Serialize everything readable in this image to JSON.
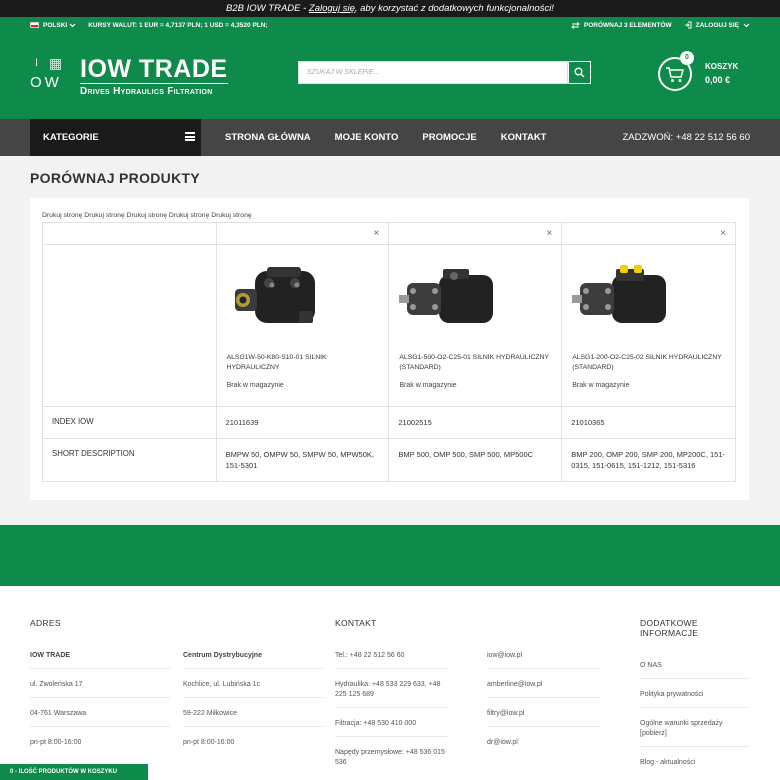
{
  "banner": {
    "pre": "B2B IOW TRADE - ",
    "link": "Zaloguj się",
    "post": ", aby korzystać z dodatkowych funkcjonalności!"
  },
  "topbar": {
    "language": "POLSKI",
    "currency": "KURSY WALUT: 1 EUR = 4,7137 PLN; 1 USD = 4,3520 PLN;",
    "compare": "PORÓWNAJ 3 ELEMENTÓW",
    "login": "ZALOGUJ SIĘ"
  },
  "logo": {
    "mark_top": "I",
    "mark_bottom": "OW",
    "title": "IOW TRADE",
    "subtitle": "Drives Hydraulics Filtration"
  },
  "search": {
    "placeholder": "SZUKAJ W SKLEPIE..."
  },
  "cart": {
    "count": "0",
    "label": "KOSZYK",
    "amount": "0,00 €"
  },
  "nav": {
    "categories": "KATEGORIE",
    "links": [
      "STRONA GŁÓWNA",
      "MOJE KONTO",
      "PROMOCJE",
      "KONTAKT"
    ],
    "phone": "ZADZWOŃ: +48 22 512 56 60"
  },
  "page": {
    "title": "PORÓWNAJ PRODUKTY",
    "print": "Drukuj stronę Drukuj stronę Drukuj stronę Drukuj stronę Drukuj stronę"
  },
  "compare": {
    "remove_glyph": "×",
    "labels": {
      "index": "INDEX IOW",
      "desc": "SHORT DESCRIPTION"
    },
    "products": [
      {
        "name": "ALSG1W-50-K80-S10-01 SILNIK HYDRAULICZNY",
        "stock": "Brak w magazynie",
        "index": "21011639",
        "desc": "BMPW 50, OMPW 50, SMPW 50, MPW50K, 151-5301"
      },
      {
        "name": "ALSG1-500-O2-C25-01 SILNIK HYDRAULICZNY (STANDARD)",
        "stock": "Brak w magazynie",
        "index": "21002515",
        "desc": "BMP 500, OMP 500, SMP 500, MP500C"
      },
      {
        "name": "ALSG1-200-O2-C25-02 SILNIK HYDRAULICZNY (STANDARD)",
        "stock": "Brak w magazynie",
        "index": "21010365",
        "desc": "BMP 200, OMP 200, SMP 200, MP200C, 151-0315, 151-0615, 151-1212, 151-5316"
      }
    ]
  },
  "footer": {
    "adres": {
      "title": "ADRES",
      "col1": [
        "IOW TRADE",
        "ul. Zwoleńska 17",
        "04-761 Warszawa",
        "pn-pt 8:00-16:00"
      ],
      "col2": [
        "Centrum Dystrybucyjne",
        "Kochlice, ul. Lubińska 1c",
        "59-222 Miłkowice",
        "pn-pt 8:00-16:00"
      ]
    },
    "kontakt": {
      "title": "KONTAKT",
      "col1": [
        "Tel.: +48 22 512 56 60",
        "Hydraulika: +48 533 229 633, +48 225 125 689",
        "Filtracja: +48 530 410 000",
        "Napędy przemysłowe: +48 536 015 536"
      ],
      "col2": [
        "iow@iow.pl",
        "amberline@iow.pl",
        "filtry@iow.pl",
        "dr@iow.pl"
      ]
    },
    "info": {
      "title": "DODATKOWE INFORMACJE",
      "items": [
        "O NAS",
        "Polityka prywatności",
        "Ogólne warunki sprzedaży [pobierz]",
        "Blog - aktualności"
      ]
    }
  },
  "cartbar": "0 - ILOŚĆ PRODUKTÓW W KOSZYKU",
  "colors": {
    "brand_green": "#0e8a4a",
    "dark": "#1a1a1a",
    "nav_gray": "#454545"
  }
}
